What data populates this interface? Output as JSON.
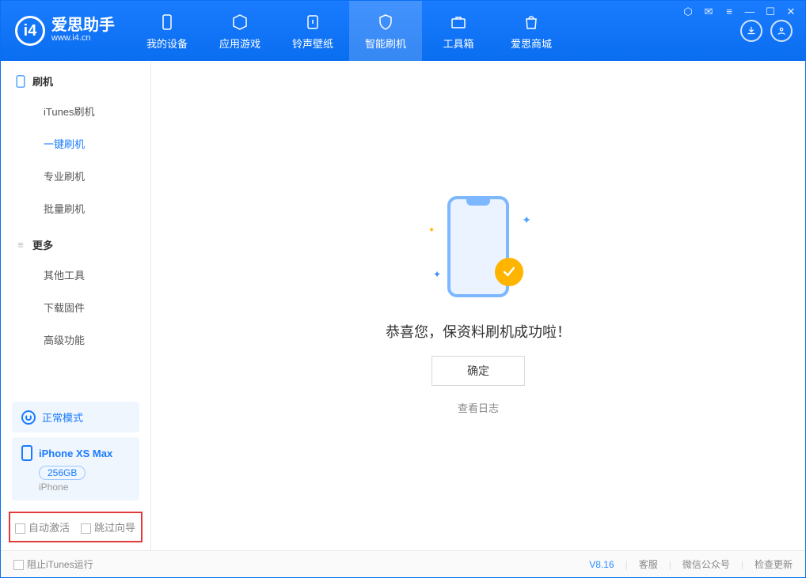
{
  "app": {
    "name_cn": "爱思助手",
    "name_en": "www.i4.cn"
  },
  "nav": {
    "tabs": [
      {
        "label": "我的设备"
      },
      {
        "label": "应用游戏"
      },
      {
        "label": "铃声壁纸"
      },
      {
        "label": "智能刷机"
      },
      {
        "label": "工具箱"
      },
      {
        "label": "爱思商城"
      }
    ]
  },
  "sidebar": {
    "section1": {
      "title": "刷机",
      "items": [
        "iTunes刷机",
        "一键刷机",
        "专业刷机",
        "批量刷机"
      ]
    },
    "section2": {
      "title": "更多",
      "items": [
        "其他工具",
        "下载固件",
        "高级功能"
      ]
    },
    "mode_card": "正常模式",
    "device": {
      "name": "iPhone XS Max",
      "storage": "256GB",
      "type": "iPhone"
    },
    "options": {
      "auto_activate": "自动激活",
      "skip_guide": "跳过向导"
    }
  },
  "main": {
    "message": "恭喜您，保资料刷机成功啦！",
    "ok_label": "确定",
    "log_link": "查看日志"
  },
  "footer": {
    "block_itunes": "阻止iTunes运行",
    "version": "V8.16",
    "links": [
      "客服",
      "微信公众号",
      "检查更新"
    ]
  }
}
